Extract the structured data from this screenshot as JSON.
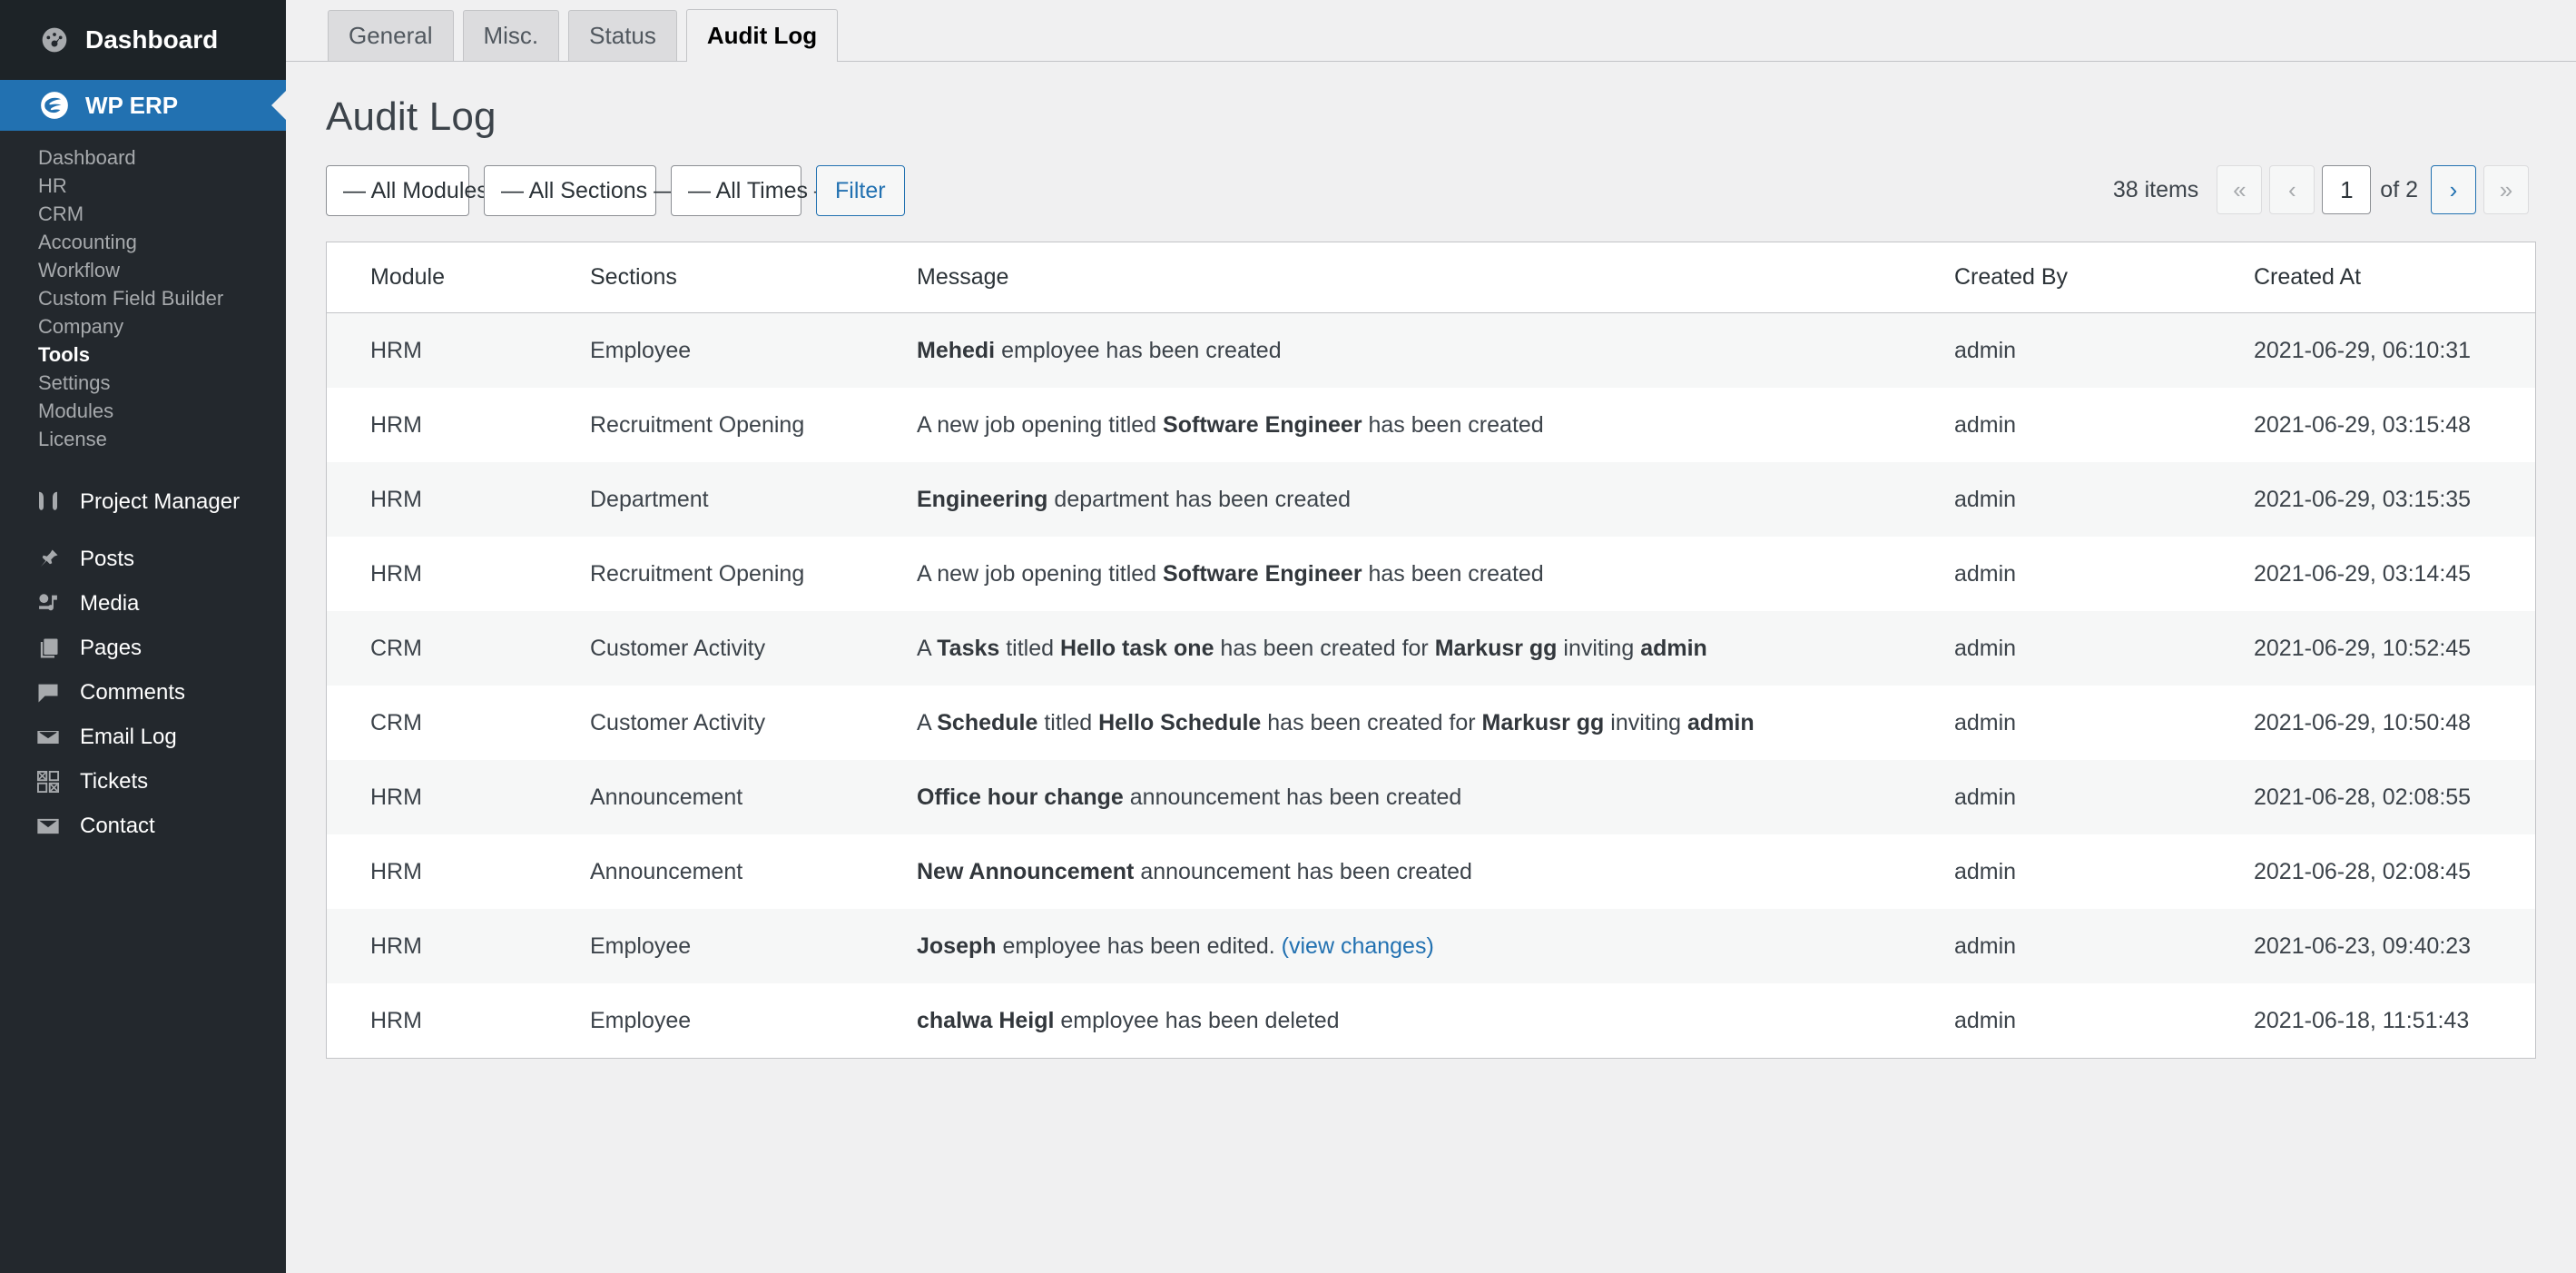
{
  "sidebar": {
    "dashboard_top": {
      "label": "Dashboard",
      "icon": "dashboard-gauge-icon"
    },
    "erp": {
      "label": "WP ERP",
      "icon": "wperp-logo-icon",
      "accent": "#2271b1"
    },
    "sub_items": [
      {
        "label": "Dashboard",
        "active": false
      },
      {
        "label": "HR",
        "active": false
      },
      {
        "label": "CRM",
        "active": false
      },
      {
        "label": "Accounting",
        "active": false
      },
      {
        "label": "Workflow",
        "active": false
      },
      {
        "label": "Custom Field Builder",
        "active": false
      },
      {
        "label": "Company",
        "active": false
      },
      {
        "label": "Tools",
        "active": true
      },
      {
        "label": "Settings",
        "active": false
      },
      {
        "label": "Modules",
        "active": false
      },
      {
        "label": "License",
        "active": false
      }
    ],
    "items": [
      {
        "label": "Project Manager",
        "icon": "project-manager-icon"
      },
      {
        "label": "Posts",
        "icon": "pin-icon"
      },
      {
        "label": "Media",
        "icon": "media-icon"
      },
      {
        "label": "Pages",
        "icon": "pages-icon"
      },
      {
        "label": "Comments",
        "icon": "comment-bubble-icon"
      },
      {
        "label": "Email Log",
        "icon": "envelope-open-icon"
      },
      {
        "label": "Tickets",
        "icon": "tickets-grid-icon"
      },
      {
        "label": "Contact",
        "icon": "envelope-icon"
      }
    ]
  },
  "tabs": [
    {
      "label": "General",
      "active": false
    },
    {
      "label": "Misc.",
      "active": false
    },
    {
      "label": "Status",
      "active": false
    },
    {
      "label": "Audit Log",
      "active": true
    }
  ],
  "page": {
    "title": "Audit Log"
  },
  "filters": {
    "modules": {
      "value": "— All Modules —",
      "caret": "chevron-down-icon"
    },
    "sections": {
      "value": "— All Sections —",
      "caret": "chevron-down-icon"
    },
    "times": {
      "value": "— All Times —",
      "caret": "chevron-down-icon"
    },
    "filter_button": "Filter"
  },
  "pagination": {
    "items_text": "38 items",
    "first": "«",
    "prev": "‹",
    "current_page": "1",
    "of_text": "of 2",
    "next": "›",
    "last": "»"
  },
  "table": {
    "headers": [
      "Module",
      "Sections",
      "Message",
      "Created By",
      "Created At"
    ],
    "rows": [
      {
        "module": "HRM",
        "section": "Employee",
        "message_html": "<b>Mehedi</b> employee has been created",
        "created_by": "admin",
        "created_at": "2021-06-29, 06:10:31"
      },
      {
        "module": "HRM",
        "section": "Recruitment Opening",
        "message_html": "A new job opening titled <b>Software Engineer</b> has been created",
        "created_by": "admin",
        "created_at": "2021-06-29, 03:15:48"
      },
      {
        "module": "HRM",
        "section": "Department",
        "message_html": "<b>Engineering</b> department has been created",
        "created_by": "admin",
        "created_at": "2021-06-29, 03:15:35"
      },
      {
        "module": "HRM",
        "section": "Recruitment Opening",
        "message_html": "A new job opening titled <b>Software Engineer</b> has been created",
        "created_by": "admin",
        "created_at": "2021-06-29, 03:14:45"
      },
      {
        "module": "CRM",
        "section": "Customer Activity",
        "message_html": "A <b>Tasks</b> titled <b>Hello task one</b> has been created for <b>Markusr gg</b> inviting <b>admin</b>",
        "created_by": "admin",
        "created_at": "2021-06-29, 10:52:45"
      },
      {
        "module": "CRM",
        "section": "Customer Activity",
        "message_html": "A <b>Schedule</b> titled <b>Hello Schedule</b> has been created for <b>Markusr gg</b> inviting <b>admin</b>",
        "created_by": "admin",
        "created_at": "2021-06-29, 10:50:48"
      },
      {
        "module": "HRM",
        "section": "Announcement",
        "message_html": "<b>Office hour change</b> announcement has been created",
        "created_by": "admin",
        "created_at": "2021-06-28, 02:08:55"
      },
      {
        "module": "HRM",
        "section": "Announcement",
        "message_html": "<b>New Announcement</b> announcement has been created",
        "created_by": "admin",
        "created_at": "2021-06-28, 02:08:45"
      },
      {
        "module": "HRM",
        "section": "Employee",
        "message_html": "<b>Joseph</b> employee has been edited. <a href=\"#\">(view changes)</a>",
        "created_by": "admin",
        "created_at": "2021-06-23, 09:40:23"
      },
      {
        "module": "HRM",
        "section": "Employee",
        "message_html": "<b>chalwa Heigl</b> employee has been deleted",
        "created_by": "admin",
        "created_at": "2021-06-18, 11:51:43"
      }
    ]
  }
}
